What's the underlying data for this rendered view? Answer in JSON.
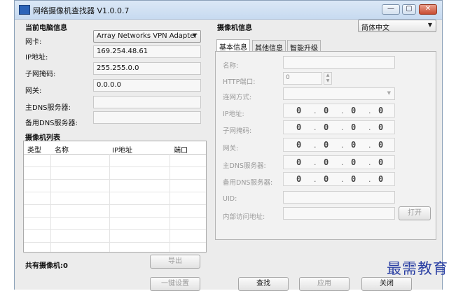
{
  "window": {
    "title": "网络摄像机查找器 V1.0.0.7",
    "minimize": "—",
    "maximize": "▢",
    "close": "✕"
  },
  "pc_info": {
    "heading": "当前电脑信息",
    "nic_label": "网卡:",
    "nic_value": "Array Networks VPN Adapter",
    "ip_label": "IP地址:",
    "ip_value": "169.254.48.61",
    "mask_label": "子网掩码:",
    "mask_value": "255.255.0.0",
    "gw_label": "网关:",
    "gw_value": "0.0.0.0",
    "dns1_label": "主DNS服务器:",
    "dns1_value": "",
    "dns2_label": "备用DNS服务器:",
    "dns2_value": ""
  },
  "camera_list": {
    "heading": "摄像机列表",
    "columns": [
      "类型",
      "名称",
      "IP地址",
      "端口"
    ],
    "count_text": "共有摄像机:0",
    "export_label": "导出",
    "oneclick_label": "一键设置"
  },
  "camera_info": {
    "heading": "摄像机信息",
    "language": "简体中文",
    "tabs": [
      "基本信息",
      "其他信息",
      "智能升级"
    ],
    "fields": {
      "name": "名称:",
      "http_port": "HTTP端口:",
      "http_port_value": "0",
      "conn_type": "连网方式:",
      "ip": "IP地址:",
      "mask": "子网掩码:",
      "gateway": "网关:",
      "dns1": "主DNS服务器:",
      "dns2": "备用DNS服务器:",
      "uid": "UID:",
      "intranet": "内部访问地址:",
      "open_label": "打开"
    },
    "ip_octets": {
      "ip": [
        "0",
        "0",
        "0",
        "0"
      ],
      "mask": [
        "0",
        "0",
        "0",
        "0"
      ],
      "gateway": [
        "0",
        "0",
        "0",
        "0"
      ],
      "dns1": [
        "0",
        "0",
        "0",
        "0"
      ],
      "dns2": [
        "0",
        "0",
        "0",
        "0"
      ]
    },
    "search_label": "查找",
    "apply_label": "应用",
    "close_label": "关闭"
  },
  "watermark": "最需教育",
  "colors": {
    "titlebar": "#c7daf0",
    "close_button": "#c84c32",
    "watermark": "#2a3fa3"
  }
}
